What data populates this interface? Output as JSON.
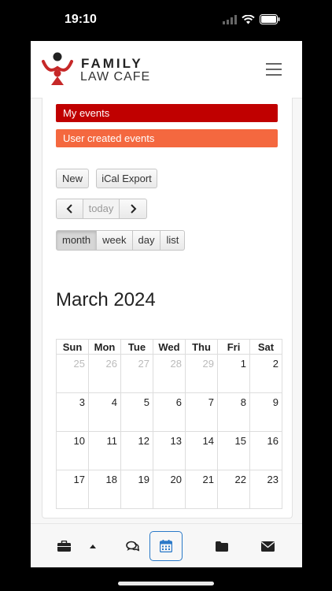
{
  "status_bar": {
    "time": "19:10"
  },
  "brand": {
    "line1": "FAMILY",
    "line2": "LAW CAFE"
  },
  "legend": {
    "my_events": "My events",
    "user_events": "User created events"
  },
  "actions": {
    "new_label": "New",
    "ical_label": "iCal Export"
  },
  "nav": {
    "prev": "‹",
    "today": "today",
    "next": "›"
  },
  "views": {
    "month": "month",
    "week": "week",
    "day": "day",
    "list": "list",
    "active": "month"
  },
  "calendar": {
    "title": "March 2024",
    "weekdays": [
      "Sun",
      "Mon",
      "Tue",
      "Wed",
      "Thu",
      "Fri",
      "Sat"
    ],
    "weeks": [
      [
        "25",
        "26",
        "27",
        "28",
        "29",
        "1",
        "2"
      ],
      [
        "3",
        "4",
        "5",
        "6",
        "7",
        "8",
        "9"
      ],
      [
        "10",
        "11",
        "12",
        "13",
        "14",
        "15",
        "16"
      ],
      [
        "17",
        "18",
        "19",
        "20",
        "21",
        "22",
        "23"
      ]
    ],
    "first_week_other_month_count": 5
  },
  "bottom_tabs": [
    "briefcase-icon",
    "chevron-up-icon",
    "chat-icon",
    "calendar-icon",
    "folder-icon",
    "mail-icon"
  ],
  "colors": {
    "my_events": "#c00000",
    "user_events": "#f4683f",
    "active_tab": "#2a79c8"
  }
}
